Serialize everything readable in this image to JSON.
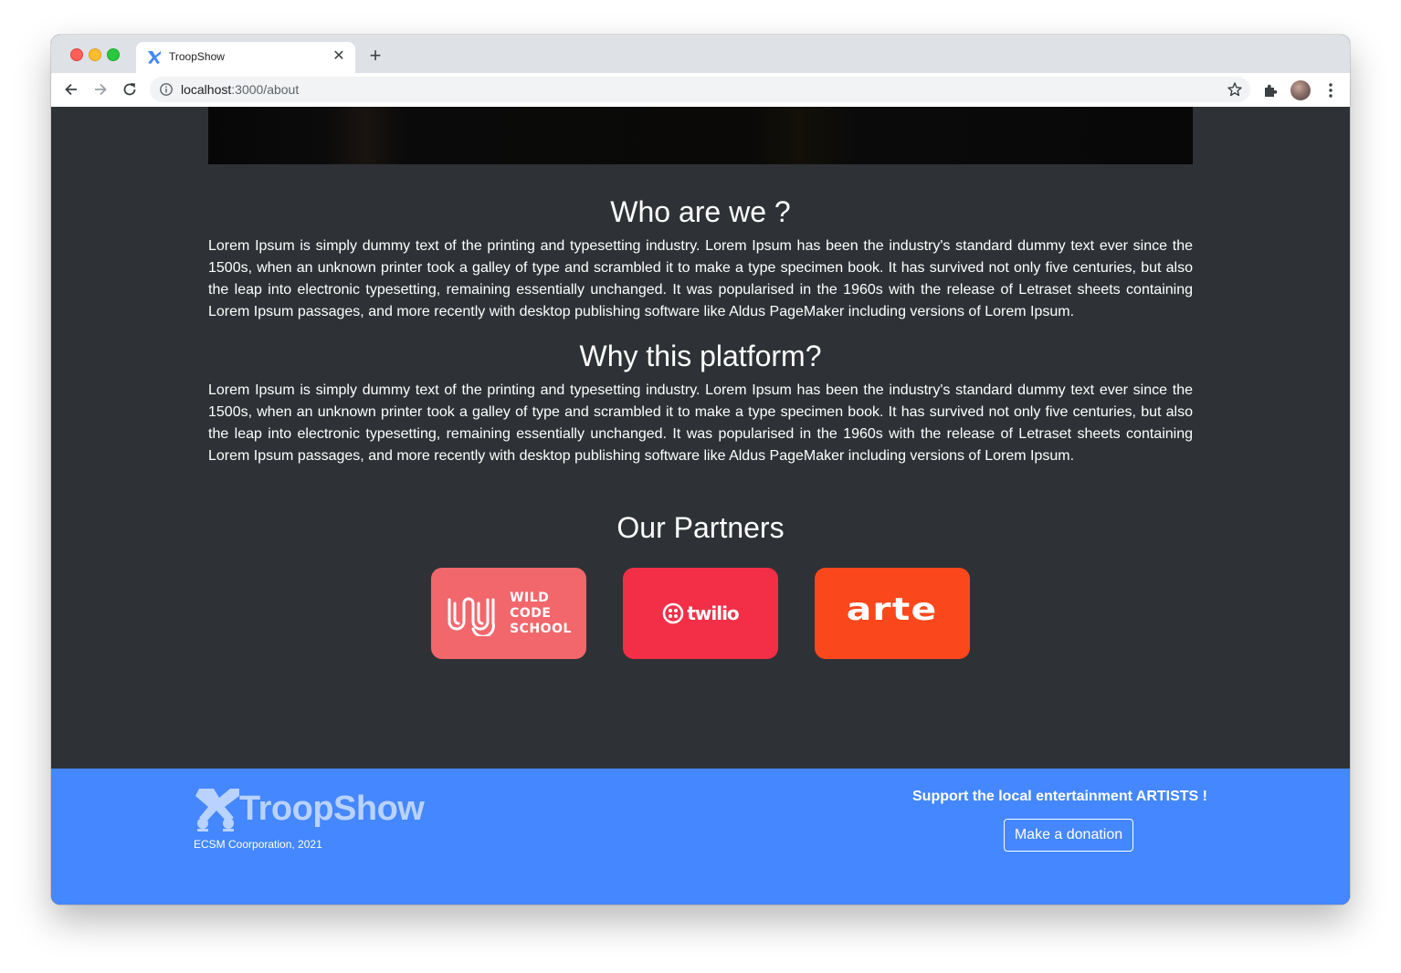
{
  "browser": {
    "tab_title": "TroopShow",
    "tab_close": "✕",
    "new_tab": "+",
    "url_host": "localhost",
    "url_rest": ":3000/about"
  },
  "about": {
    "sections": [
      {
        "title": "Who are we ?",
        "body": "Lorem Ipsum is simply dummy text of the printing and typesetting industry. Lorem Ipsum has been the industry's standard dummy text ever since the 1500s, when an unknown printer took a galley of type and scrambled it to make a type specimen book. It has survived not only five centuries, but also the leap into electronic typesetting, remaining essentially unchanged. It was popularised in the 1960s with the release of Letraset sheets containing Lorem Ipsum passages, and more recently with desktop publishing software like Aldus PageMaker including versions of Lorem Ipsum."
      },
      {
        "title": "Why this platform?",
        "body": "Lorem Ipsum is simply dummy text of the printing and typesetting industry. Lorem Ipsum has been the industry's standard dummy text ever since the 1500s, when an unknown printer took a galley of type and scrambled it to make a type specimen book. It has survived not only five centuries, but also the leap into electronic typesetting, remaining essentially unchanged. It was popularised in the 1960s with the release of Letraset sheets containing Lorem Ipsum passages, and more recently with desktop publishing software like Aldus PageMaker including versions of Lorem Ipsum."
      }
    ]
  },
  "partners": {
    "title": "Our Partners",
    "items": [
      {
        "name": "Wild Code School",
        "lines": [
          "WILD",
          "CODE",
          "SCHOOL"
        ],
        "color": "#f1676c"
      },
      {
        "name": "twilio",
        "text": "twilio",
        "color": "#f22f46"
      },
      {
        "name": "arte",
        "text": "arte",
        "color": "#fa481c"
      }
    ]
  },
  "footer": {
    "brand": "TroopShow",
    "copyright": "ECSM Coorporation, 2021",
    "support": "Support the local entertainment ARTISTS !",
    "donate_label": "Make a donation",
    "color": "#4487fe"
  },
  "colors": {
    "page_bg": "#2e3236",
    "accent": "#4487fe"
  }
}
